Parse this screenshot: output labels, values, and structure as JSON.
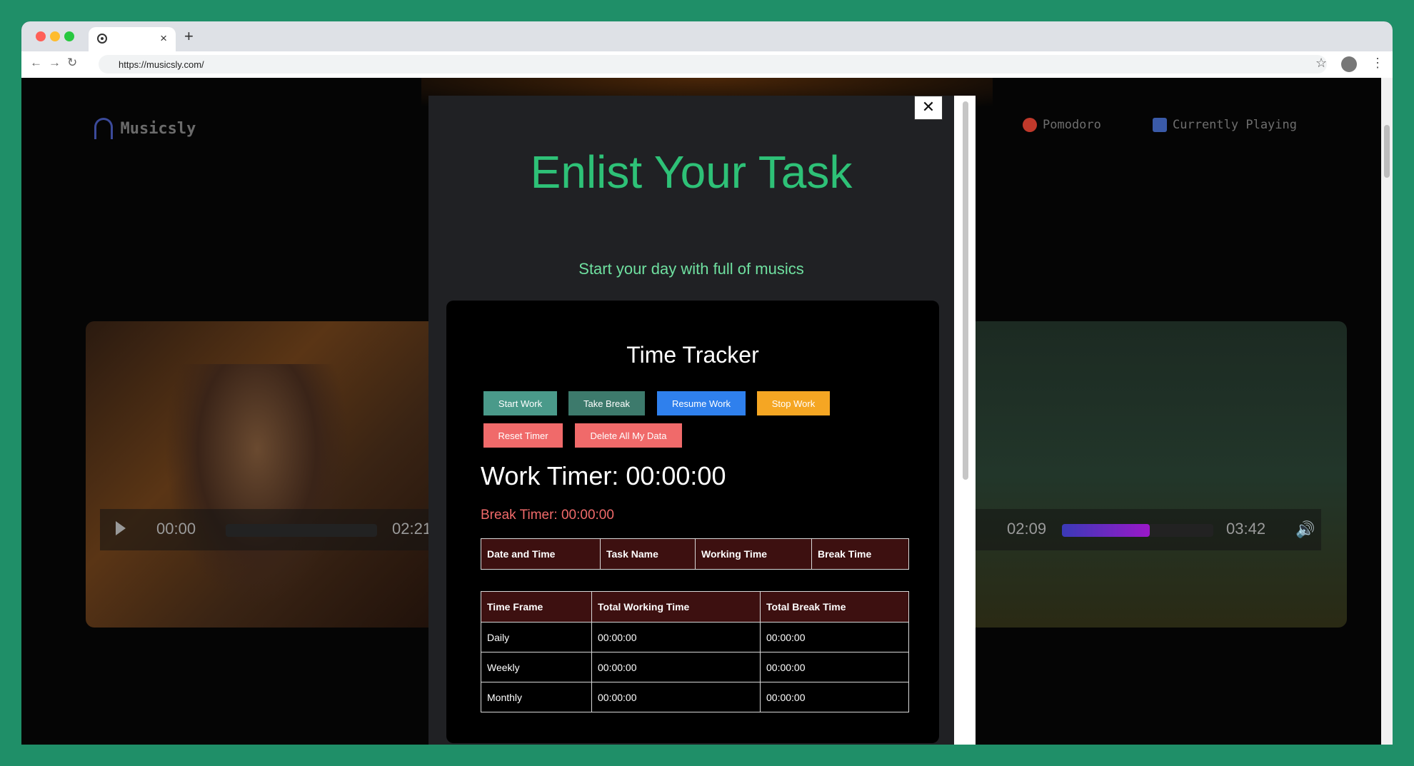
{
  "browser": {
    "tab_close": "×",
    "new_tab": "+",
    "url": "https://musicsly.com/",
    "nav": {
      "back": "←",
      "forward": "→",
      "reload": "↻"
    },
    "star": "☆",
    "menu": "⋮"
  },
  "site": {
    "logo": "Musicsly",
    "nav": [
      {
        "label": "Pomodoro",
        "icon": "tomato-icon"
      },
      {
        "label": "Currently Playing",
        "icon": "music-notes-icon"
      }
    ]
  },
  "players": [
    {
      "current": "00:00",
      "duration": "02:21",
      "progress": 0.0
    },
    {
      "current": "02:09",
      "duration": "03:42",
      "progress": 0.58
    }
  ],
  "modal": {
    "close": "✕",
    "title": "Enlist Your Task",
    "subtitle": "Start your day with full of musics",
    "tracker_title": "Time Tracker",
    "buttons": {
      "start": "Start Work",
      "break": "Take Break",
      "resume": "Resume Work",
      "stop": "Stop Work",
      "reset": "Reset Timer",
      "delete": "Delete All My Data"
    },
    "work_timer": "Work Timer: 00:00:00",
    "break_timer": "Break Timer: 00:00:00",
    "tasks_table": {
      "headers": [
        "Date and Time",
        "Task Name",
        "Working Time",
        "Break Time"
      ]
    },
    "summary_table": {
      "headers": [
        "Time Frame",
        "Total Working Time",
        "Total Break Time"
      ],
      "rows": [
        [
          "Daily",
          "00:00:00",
          "00:00:00"
        ],
        [
          "Weekly",
          "00:00:00",
          "00:00:00"
        ],
        [
          "Monthly",
          "00:00:00",
          "00:00:00"
        ]
      ]
    }
  },
  "colors": {
    "accent_green": "#2ec177",
    "start_btn": "#4a9a8a",
    "break_btn": "#3d7a6c",
    "resume_btn": "#2f80ed",
    "stop_btn": "#f5a623",
    "reset_btn": "#f06a6a",
    "table_header": "#3d1010"
  }
}
